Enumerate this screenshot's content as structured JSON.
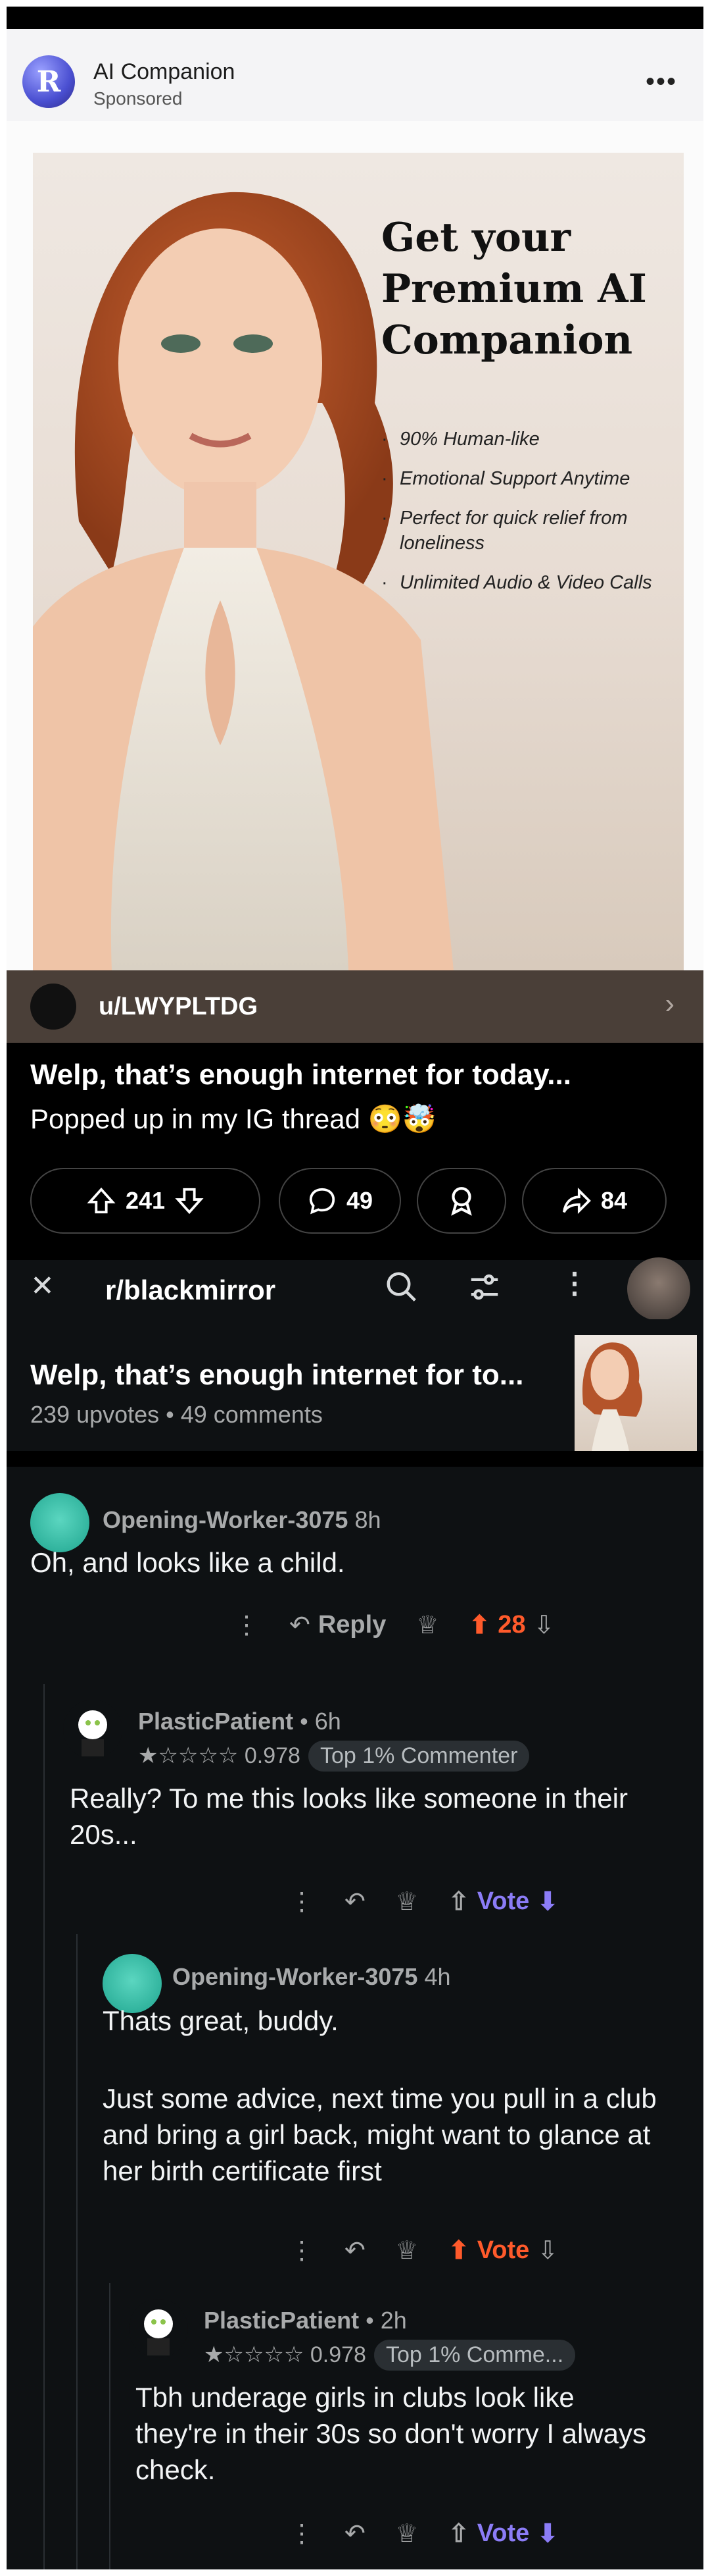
{
  "ad": {
    "title": "AI Companion",
    "subtitle": "Sponsored",
    "logo_letter": "R",
    "more": "•••",
    "poster_title": "Get your Premium AI Companion",
    "bullets": [
      "90% Human-like",
      "Emotional Support Anytime",
      "Perfect for quick relief from loneliness",
      "Unlimited Audio & Video Calls"
    ],
    "user": "u/LWYPLTDG",
    "post_title": "Welp, that’s enough internet for today...",
    "post_body": "Popped up in my IG thread 😳🤯",
    "upvotes": "241",
    "comments": "49",
    "shares": "84"
  },
  "thread": {
    "subreddit": "r/blackmirror",
    "post_title": "Welp, that’s enough internet for to...",
    "meta": "239 upvotes • 49 comments",
    "comments": [
      {
        "user": "Opening-Worker-3075",
        "time": "8h",
        "text": "Oh, and looks like a child.",
        "reply": "Reply",
        "votes": "28"
      },
      {
        "user": "PlasticPatient",
        "time": "• 6h",
        "rating": "★☆☆☆☆ 0.978",
        "flair": "Top 1% Commenter",
        "text": "Really? To me this looks like someone in their 20s...",
        "votes": "Vote"
      },
      {
        "user": "Opening-Worker-3075",
        "time": "4h",
        "text1": "Thats great, buddy.",
        "text2": "Just some advice, next time you pull in a club and bring a girl back, might want to glance at her birth certificate first",
        "votes": "Vote"
      },
      {
        "user": "PlasticPatient",
        "time": "• 2h",
        "rating": "★☆☆☆☆ 0.978",
        "flair": "Top 1% Comme...",
        "text": "Tbh underage girls in clubs look like they're in their 30s so don't worry I always check.",
        "votes": "Vote"
      }
    ]
  },
  "icons": [
    "close-icon",
    "search-icon",
    "filter-icon",
    "more-icon",
    "upvote-icon",
    "downvote-icon",
    "comment-icon",
    "award-icon",
    "share-icon",
    "reply-icon"
  ],
  "colors": {
    "accent_orange": "#ff5a2b",
    "vote_purple": "#8b7cf6",
    "thread_bg": "#0e1113"
  }
}
